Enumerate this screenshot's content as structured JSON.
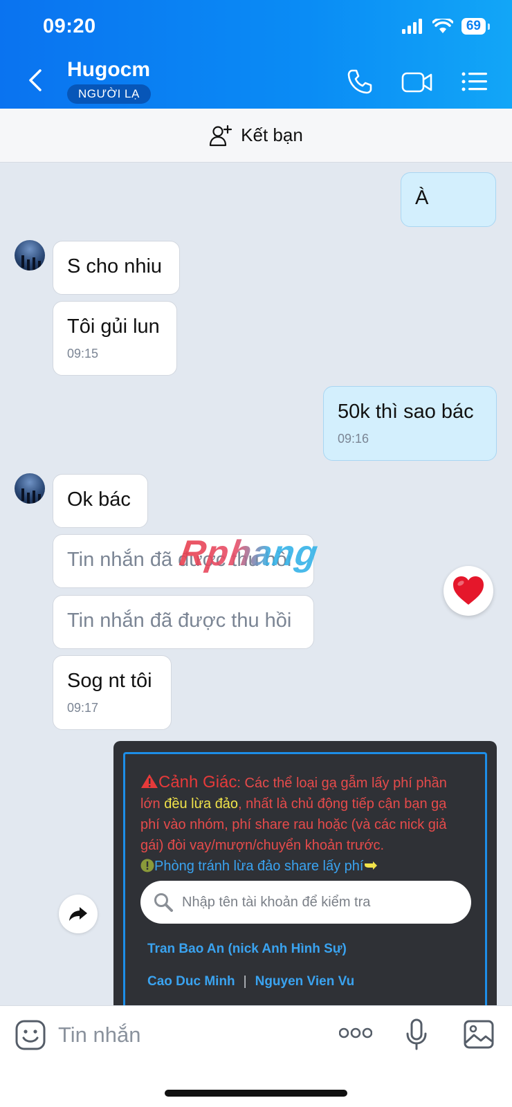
{
  "status": {
    "time": "09:20",
    "battery": "69"
  },
  "header": {
    "contact_name": "Hugocm",
    "badge": "NGƯỜI LẠ"
  },
  "add_friend": {
    "label": "Kết bạn"
  },
  "messages": [
    {
      "text": "À"
    },
    {
      "text": "S cho nhiu"
    },
    {
      "text": "Tôi gủi lun",
      "time": "09:15"
    },
    {
      "text": "50k thì sao bác",
      "time": "09:16"
    },
    {
      "text": "Ok bác"
    },
    {
      "text": "Tin nhắn đã được thu hồi"
    },
    {
      "text": "Tin nhắn đã được thu hồi"
    },
    {
      "text": "Sog nt tôi",
      "time": "09:17"
    }
  ],
  "watermark": "Rphang",
  "warning_card": {
    "title": "Cảnh Giác",
    "part1": ": Các thể loại gạ gẫm lấy phí phần lớn ",
    "highlight": "đều lừa đảo",
    "part2": ", nhất là chủ động tiếp cận bạn gạ phí vào nhóm, phí share rau hoặc (và các nick giả gái) đòi vay/mượn/chuyển khoản trước.",
    "line2": "Phòng tránh lừa đảo share lấy phí",
    "search_placeholder": "Nhập tên tài khoản để kiểm tra",
    "links": [
      "Tran Bao An (nick Anh Hình Sự)",
      "Cao Duc Minh",
      "Nguyen Vien Vu"
    ]
  },
  "composer": {
    "placeholder": "Tin nhắn"
  },
  "colors": {
    "header": "#0a80f3",
    "my_bubble": "#d3effd",
    "card_bg": "#2f3136",
    "warning": "#e64b4b",
    "link": "#3aa3f0"
  }
}
